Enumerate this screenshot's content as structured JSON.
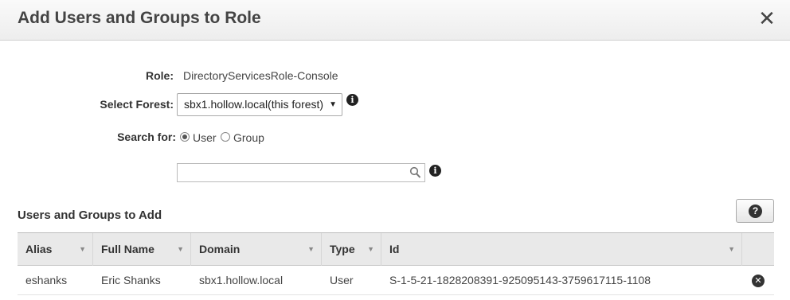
{
  "dialog": {
    "title": "Add Users and Groups to Role",
    "close_symbol": "✕"
  },
  "form": {
    "role_label": "Role:",
    "role_value": "DirectoryServicesRole-Console",
    "forest_label": "Select Forest:",
    "forest_selected": "sbx1.hollow.local(this forest)",
    "search_for_label": "Search for:",
    "radio_options": [
      {
        "label": "User",
        "checked": true
      },
      {
        "label": "Group",
        "checked": false
      }
    ],
    "search_value": ""
  },
  "section": {
    "title": "Users and Groups to Add",
    "help_icon": "question-icon"
  },
  "table": {
    "columns": [
      "Alias",
      "Full Name",
      "Domain",
      "Type",
      "Id"
    ],
    "rows": [
      {
        "alias": "eshanks",
        "full_name": "Eric Shanks",
        "domain": "sbx1.hollow.local",
        "type": "User",
        "id": "S-1-5-21-1828208391-925095143-3759617115-1108"
      }
    ]
  },
  "icons": {
    "info": "info-icon",
    "search": "search-icon",
    "remove": "remove-icon"
  }
}
